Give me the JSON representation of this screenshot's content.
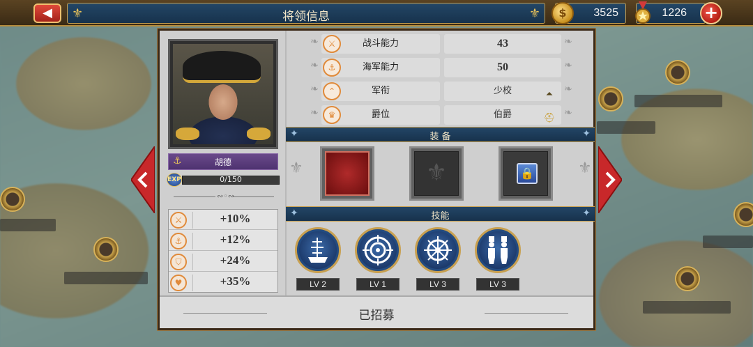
{
  "header": {
    "title": "将领信息",
    "gold": "3525",
    "medals": "1226"
  },
  "general": {
    "name": "胡德",
    "exp": "0/150",
    "exp_progress": 0.0
  },
  "bonuses": [
    {
      "icon": "crossed-swords-icon",
      "value": "+10%"
    },
    {
      "icon": "anchor-icon",
      "value": "+12%"
    },
    {
      "icon": "shield-icon",
      "value": "+24%"
    },
    {
      "icon": "heart-icon",
      "value": "+35%"
    }
  ],
  "stats": [
    {
      "label": "战斗能力",
      "value": "43"
    },
    {
      "label": "海军能力",
      "value": "50"
    },
    {
      "label": "军衔",
      "value": "少校"
    },
    {
      "label": "爵位",
      "value": "伯爵"
    }
  ],
  "sections": {
    "equipment": "装 备",
    "skills": "技能"
  },
  "equipment": [
    {
      "state": "equipped",
      "icon": "red-item-icon"
    },
    {
      "state": "empty",
      "icon": "fleur-de-lis-icon"
    },
    {
      "state": "locked",
      "icon": "lock-icon"
    }
  ],
  "skills": [
    {
      "icon": "ship-icon",
      "level": "LV 2"
    },
    {
      "icon": "target-icon",
      "level": "LV 1"
    },
    {
      "icon": "ship-wheel-icon",
      "level": "LV 3"
    },
    {
      "icon": "soldiers-icon",
      "level": "LV 3"
    }
  ],
  "footer": {
    "status": "已招募"
  },
  "colors": {
    "accent_gold": "#c8a050",
    "header_blue": "#17324c",
    "nav_red": "#c8282a"
  }
}
